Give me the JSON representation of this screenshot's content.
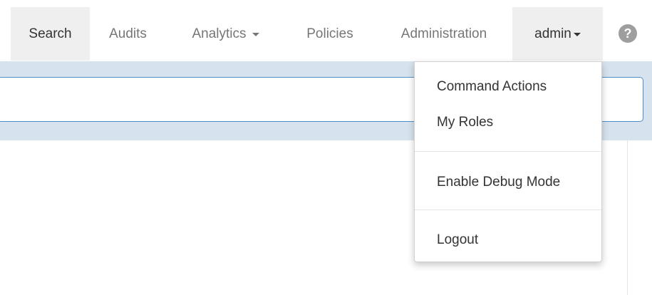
{
  "nav": {
    "search": "Search",
    "audits": "Audits",
    "analytics": "Analytics",
    "policies": "Policies",
    "administration": "Administration",
    "admin": "admin",
    "help_symbol": "?"
  },
  "search": {
    "value": "",
    "placeholder": ""
  },
  "user_menu": {
    "items": [
      {
        "label": "Command Actions"
      },
      {
        "label": "My Roles"
      },
      {
        "label": "Enable Debug Mode"
      },
      {
        "label": "Logout"
      }
    ]
  },
  "icons": {
    "help": "question-circle",
    "dropdown_caret": "caret-down"
  },
  "colors": {
    "search_strip_background": "#d6e2ed",
    "search_border": "#4c8ec7",
    "active_tab_background": "#efefef",
    "help_icon": "#9e9e9e"
  }
}
